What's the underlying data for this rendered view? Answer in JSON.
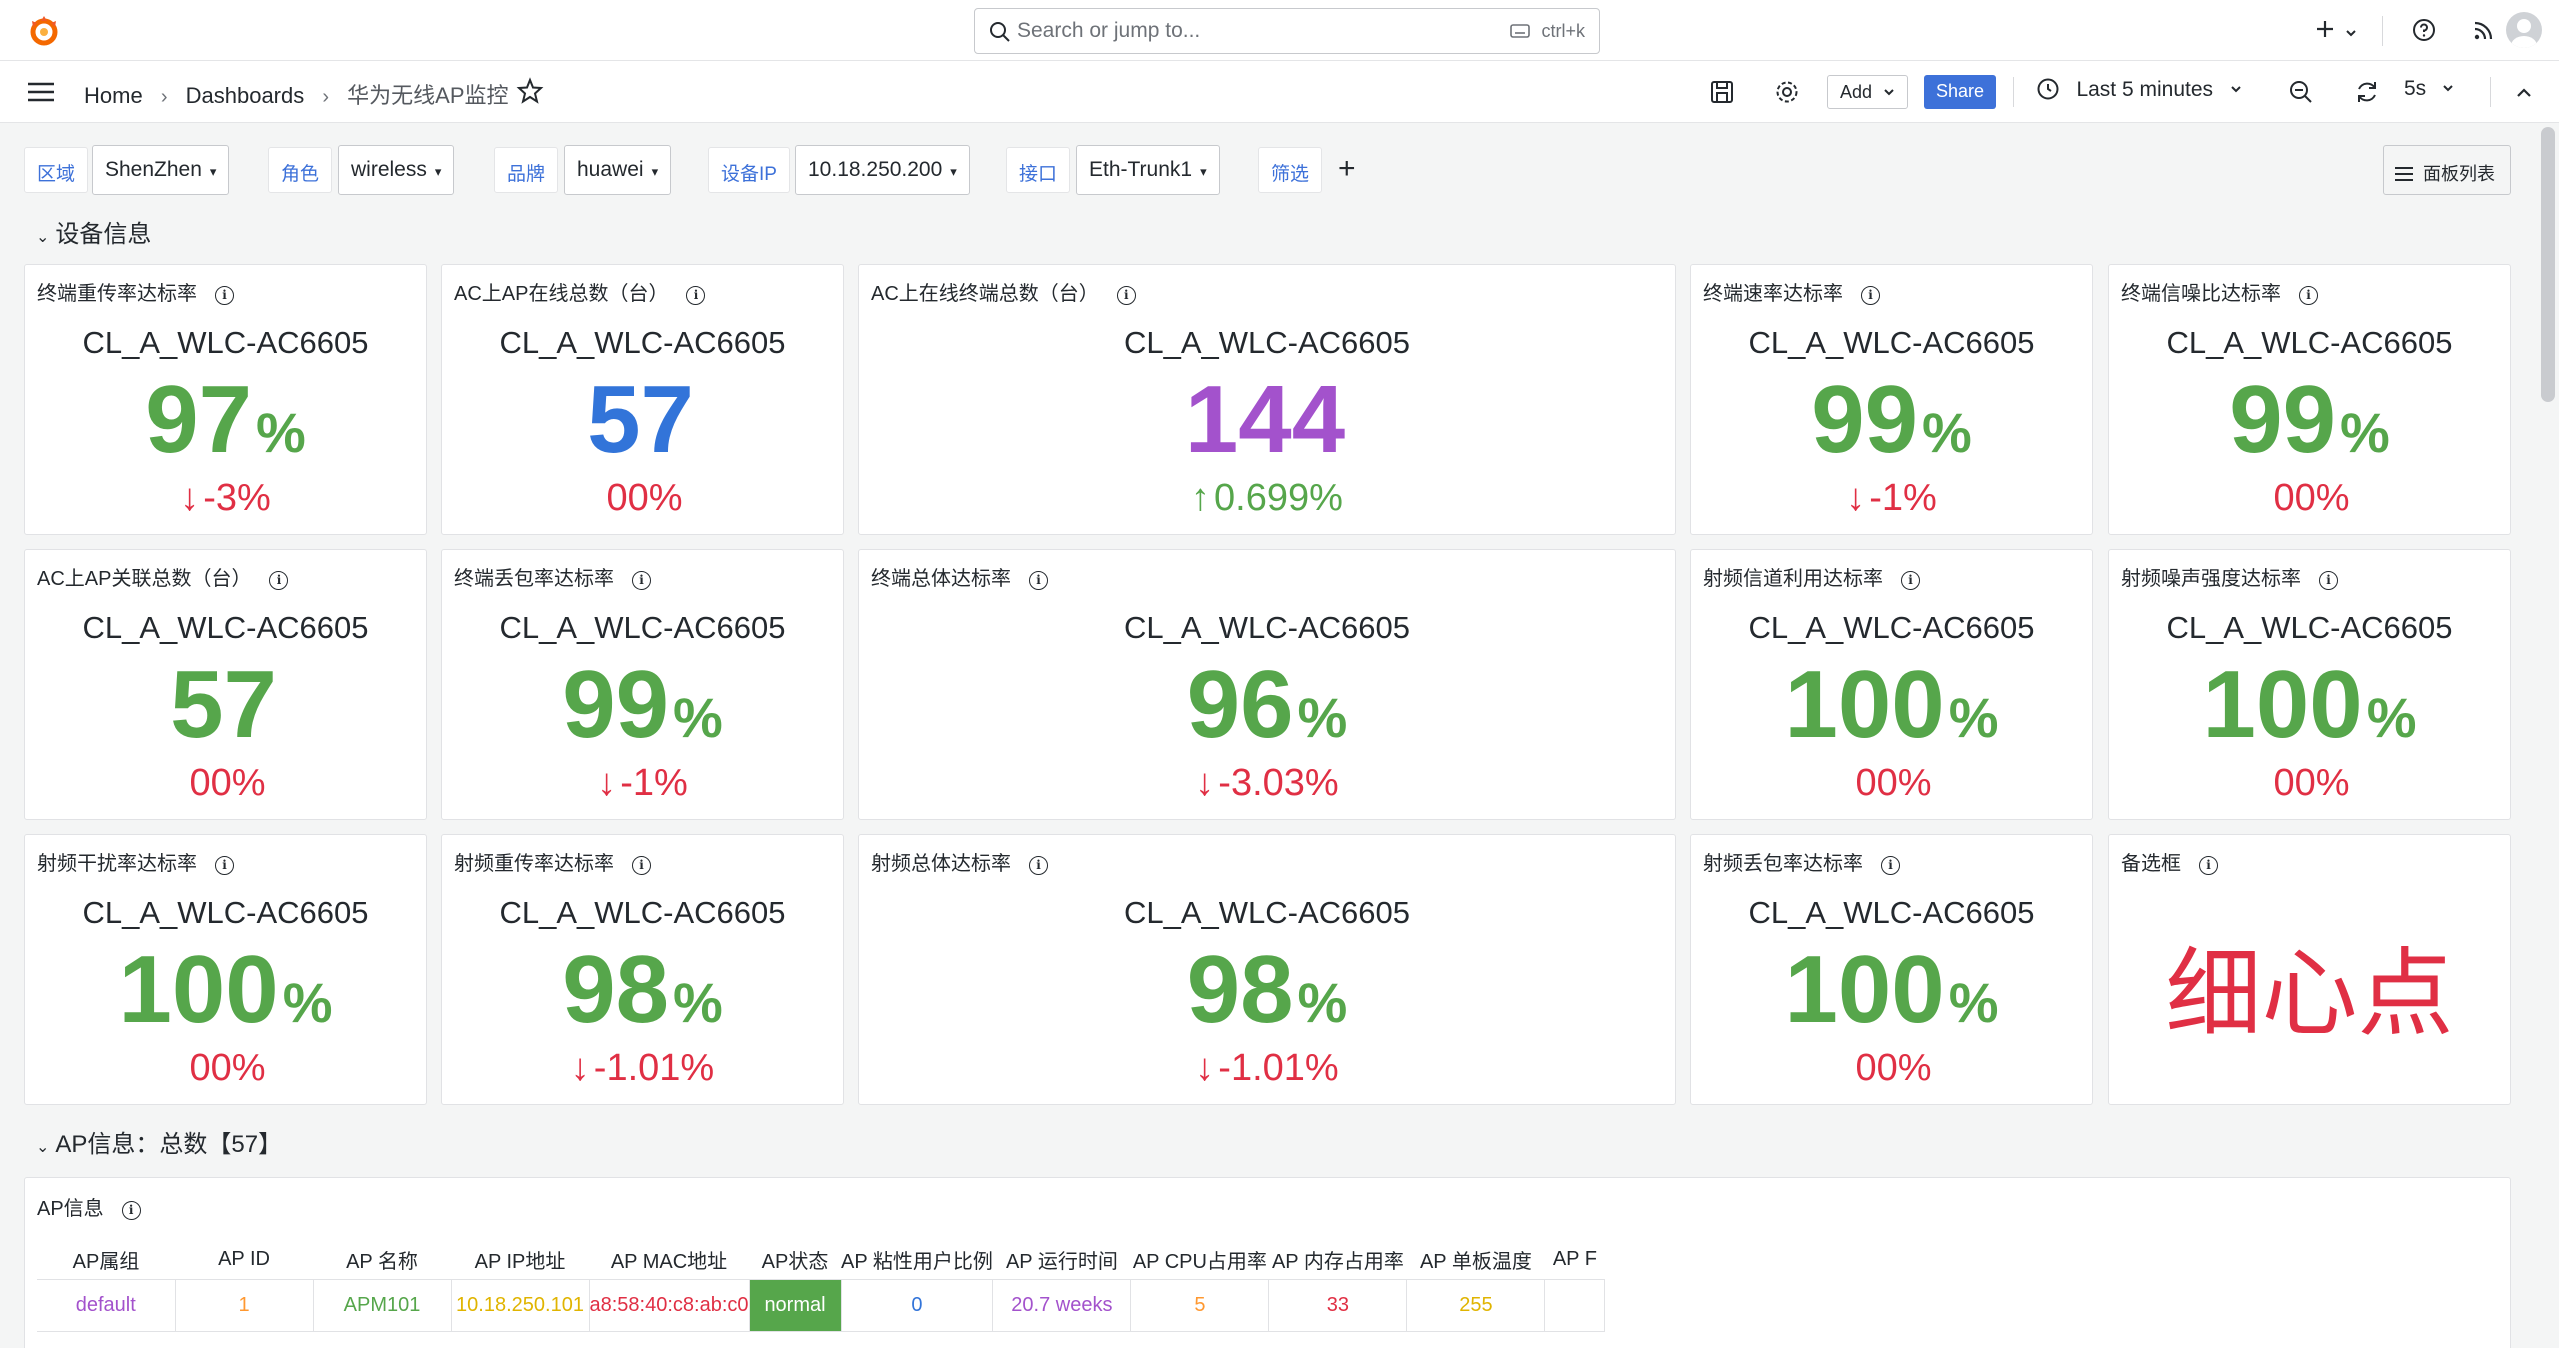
{
  "topbar": {
    "search_placeholder": "Search or jump to...",
    "search_shortcut": "ctrl+k",
    "icons": [
      "grafana-logo-icon",
      "plus-icon",
      "help-icon",
      "news-rss-icon",
      "user-avatar-icon"
    ]
  },
  "nav": {
    "breadcrumb": [
      "Home",
      "Dashboards",
      "华为无线AP监控"
    ],
    "add_label": "Add",
    "share_label": "Share",
    "time_range": "Last 5 minutes",
    "refresh_interval": "5s"
  },
  "variables": [
    {
      "label": "区域",
      "value": "ShenZhen"
    },
    {
      "label": "角色",
      "value": "wireless"
    },
    {
      "label": "品牌",
      "value": "huawei"
    },
    {
      "label": "设备IP",
      "value": "10.18.250.200"
    },
    {
      "label": "接口",
      "value": "Eth-Trunk1"
    },
    {
      "label": "筛选",
      "value": ""
    }
  ],
  "panel_list_label": "面板列表",
  "rows": {
    "device_info": "设备信息",
    "ap_info": "AP信息：总数【57】"
  },
  "colors": {
    "green": "#56a64b",
    "blue": "#3274d9",
    "purple": "#a352cc",
    "red": "#e02f44",
    "orange": "#ff9830",
    "yellow": "#e0b400",
    "status_green": "#56a64b"
  },
  "stats": [
    {
      "title": "终端重传率达标率",
      "name": "CL_A_WLC-AC6605",
      "value": "97",
      "unit": "%",
      "value_color": "#56a64b",
      "change": "-3%",
      "arrow": "↓",
      "change_color": "#e02f44"
    },
    {
      "title": "AC上AP在线总数（台）",
      "name": "CL_A_WLC-AC6605",
      "value": "57",
      "unit": "",
      "value_color": "#3274d9",
      "change": "00%",
      "arrow": "",
      "change_color": "#e02f44"
    },
    {
      "title": "AC上在线终端总数（台）",
      "name": "CL_A_WLC-AC6605",
      "value": "144",
      "unit": "",
      "value_color": "#a352cc",
      "change": "0.699%",
      "arrow": "↑",
      "change_color": "#56a64b"
    },
    {
      "title": "终端速率达标率",
      "name": "CL_A_WLC-AC6605",
      "value": "99",
      "unit": "%",
      "value_color": "#56a64b",
      "change": "-1%",
      "arrow": "↓",
      "change_color": "#e02f44"
    },
    {
      "title": "终端信噪比达标率",
      "name": "CL_A_WLC-AC6605",
      "value": "99",
      "unit": "%",
      "value_color": "#56a64b",
      "change": "00%",
      "arrow": "",
      "change_color": "#e02f44"
    },
    {
      "title": "AC上AP关联总数（台）",
      "name": "CL_A_WLC-AC6605",
      "value": "57",
      "unit": "",
      "value_color": "#56a64b",
      "change": "00%",
      "arrow": "",
      "change_color": "#e02f44"
    },
    {
      "title": "终端丢包率达标率",
      "name": "CL_A_WLC-AC6605",
      "value": "99",
      "unit": "%",
      "value_color": "#56a64b",
      "change": "-1%",
      "arrow": "↓",
      "change_color": "#e02f44"
    },
    {
      "title": "终端总体达标率",
      "name": "CL_A_WLC-AC6605",
      "value": "96",
      "unit": "%",
      "value_color": "#56a64b",
      "change": "-3.03%",
      "arrow": "↓",
      "change_color": "#e02f44"
    },
    {
      "title": "射频信道利用达标率",
      "name": "CL_A_WLC-AC6605",
      "value": "100",
      "unit": "%",
      "value_color": "#56a64b",
      "change": "00%",
      "arrow": "",
      "change_color": "#e02f44"
    },
    {
      "title": "射频噪声强度达标率",
      "name": "CL_A_WLC-AC6605",
      "value": "100",
      "unit": "%",
      "value_color": "#56a64b",
      "change": "00%",
      "arrow": "",
      "change_color": "#e02f44"
    },
    {
      "title": "射频干扰率达标率",
      "name": "CL_A_WLC-AC6605",
      "value": "100",
      "unit": "%",
      "value_color": "#56a64b",
      "change": "00%",
      "arrow": "",
      "change_color": "#e02f44"
    },
    {
      "title": "射频重传率达标率",
      "name": "CL_A_WLC-AC6605",
      "value": "98",
      "unit": "%",
      "value_color": "#56a64b",
      "change": "-1.01%",
      "arrow": "↓",
      "change_color": "#e02f44"
    },
    {
      "title": "射频总体达标率",
      "name": "CL_A_WLC-AC6605",
      "value": "98",
      "unit": "%",
      "value_color": "#56a64b",
      "change": "-1.01%",
      "arrow": "↓",
      "change_color": "#e02f44"
    },
    {
      "title": "射频丢包率达标率",
      "name": "CL_A_WLC-AC6605",
      "value": "100",
      "unit": "%",
      "value_color": "#56a64b",
      "change": "00%",
      "arrow": "",
      "change_color": "#e02f44"
    }
  ],
  "text_panel": {
    "title": "备选框",
    "text": "细心点",
    "color": "#e02f44"
  },
  "ap_table": {
    "title": "AP信息",
    "columns": [
      "AP属组",
      "AP ID",
      "AP 名称",
      "AP IP地址",
      "AP MAC地址",
      "AP状态",
      "AP 粘性用户比例",
      "AP 运行时间",
      "AP CPU占用率",
      "AP 内存占用率",
      "AP 单板温度",
      "AP F"
    ],
    "rows": [
      [
        "default",
        "1",
        "APM101",
        "10.18.250.101",
        "a8:58:40:c8:ab:c0",
        "normal",
        "0",
        "20.7 weeks",
        "5",
        "33",
        "255",
        ""
      ]
    ],
    "cell_colors": [
      "#a352cc",
      "#ff9830",
      "#56a64b",
      "#e0b400",
      "#e02f44",
      "#ffffff",
      "#3274d9",
      "#a352cc",
      "#ff9830",
      "#e02f44",
      "#e0b400",
      "#24292e"
    ]
  }
}
